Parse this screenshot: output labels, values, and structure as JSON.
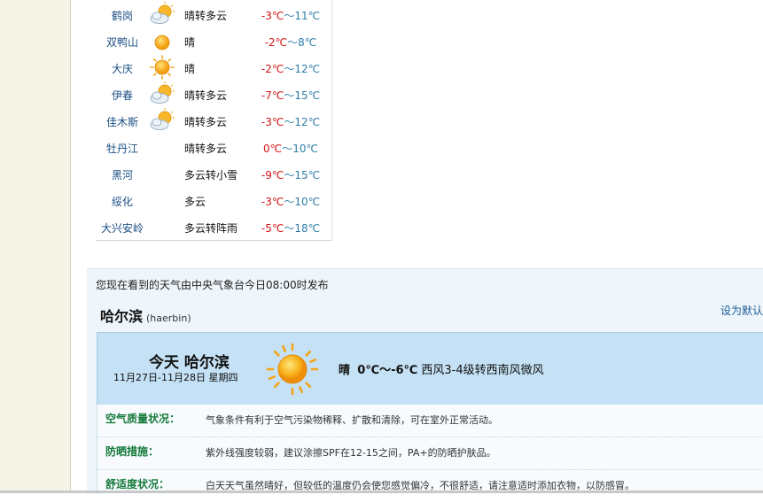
{
  "cities": [
    {
      "name": "鹤岗",
      "icon": "partly-cloudy-icon",
      "condition": "晴转多云",
      "low": "-3℃",
      "sep": "～",
      "high": "11℃"
    },
    {
      "name": "双鸭山",
      "icon": "sun-small-icon",
      "condition": "晴",
      "low": "-2℃",
      "sep": "～",
      "high": "8℃"
    },
    {
      "name": "大庆",
      "icon": "sun-icon",
      "condition": "晴",
      "low": "-2℃",
      "sep": "～",
      "high": "12℃"
    },
    {
      "name": "伊春",
      "icon": "partly-cloudy-icon",
      "condition": "晴转多云",
      "low": "-7℃",
      "sep": "～",
      "high": "15℃"
    },
    {
      "name": "佳木斯",
      "icon": "partly-cloudy-icon",
      "condition": "晴转多云",
      "low": "-3℃",
      "sep": "～",
      "high": "12℃"
    },
    {
      "name": "牡丹江",
      "icon": "",
      "condition": "晴转多云",
      "low": "0℃",
      "sep": "～",
      "high": "10℃"
    },
    {
      "name": "黑河",
      "icon": "",
      "condition": "多云转小雪",
      "low": "-9℃",
      "sep": "～",
      "high": "15℃"
    },
    {
      "name": "绥化",
      "icon": "",
      "condition": "多云",
      "low": "-3℃",
      "sep": "～",
      "high": "10℃"
    },
    {
      "name": "大兴安岭",
      "icon": "",
      "condition": "多云转阵雨",
      "low": "-5℃",
      "sep": "～",
      "high": "18℃"
    }
  ],
  "forecast": {
    "publish": "您现在看到的天气由中央气象台今日08:00时发布",
    "city": "哈尔滨",
    "pinyin": "(haerbin)",
    "set_default": "设为默认",
    "today_label": "今天  哈尔滨",
    "date": "11月27日-11月28日 星期四",
    "weather": "晴",
    "temp": "0℃～-6℃",
    "wind": "西风3-4级转西南风微风",
    "indices": [
      {
        "label": "空气质量状况：",
        "text": "气象条件有利于空气污染物稀释、扩散和清除，可在室外正常活动。"
      },
      {
        "label": "防晒措施：",
        "text": "紫外线强度较弱，建议涂擦SPF在12-15之间，PA+的防晒护肤品。"
      },
      {
        "label": "舒适度状况：",
        "text": "白天天气虽然晴好，但较低的温度仍会使您感觉偏冷，不很舒适，请注意适时添加衣物，以防感冒。"
      }
    ]
  }
}
